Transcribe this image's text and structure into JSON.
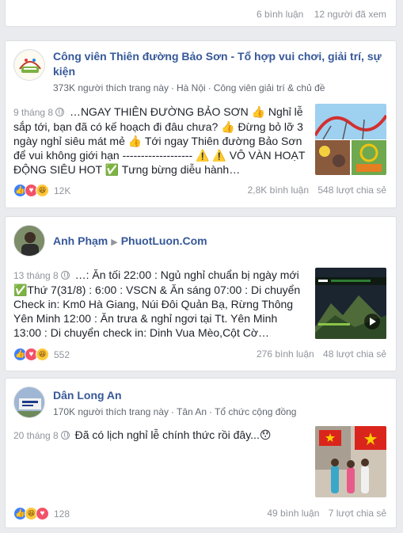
{
  "top_card": {
    "comments": "6 bình luận",
    "views": "12 người đã xem"
  },
  "posts": [
    {
      "name": "Công viên Thiên đường Bảo Sơn - Tổ hợp vui chơi, giải trí, sự kiện",
      "likes": "373K người thích trang này",
      "location": "Hà Nội",
      "category": "Công viên giải trí & chủ đề",
      "date": "9 tháng 8",
      "text": "…NGAY THIÊN ĐƯỜNG BẢO SƠN 👍 Nghỉ lễ sắp tới, bạn đã có kế hoạch đi đâu chưa? 👍 Đừng bỏ lỡ 3 ngày nghỉ siêu mát mẻ 👍 Tới ngay Thiên đường Bảo Sơn để vui không giới hạn ------------------- ⚠️ ⚠️ VÔ VÀN HOẠT ĐỘNG SIÊU HOT ✅ Tưng bừng diễu hành…",
      "reaction_count": "12K",
      "comments": "2,8K bình luận",
      "shares": "548 lượt chia sẻ"
    },
    {
      "name": "Anh Phạm",
      "shared_to": "PhuotLuon.Com",
      "date": "13 tháng 8",
      "text": "…: Ăn tối 22:00 : Ngủ nghỉ chuẩn bị ngày mới ✅Thứ 7(31/8) : 6:00 : VSCN & Ăn sáng 07:00 : Di chuyển Check in: Km0 Hà Giang, Núi Đôi Quản Bạ, Rừng Thông Yên Minh 12:00 : Ăn trưa & nghỉ ngơi tại Tt. Yên Minh 13:00 : Di chuyển check in: Dinh Vua Mèo,Cột Cờ…",
      "reaction_count": "552",
      "comments": "276 bình luận",
      "shares": "48 lượt chia sẻ"
    },
    {
      "name": "Dân Long An",
      "likes": "170K người thích trang này",
      "location": "Tân An",
      "category": "Tổ chức cộng đồng",
      "date": "20 tháng 8",
      "text": "Đã có lịch nghỉ lễ chính thức rồi đây...😯",
      "reaction_count": "128",
      "comments": "49 bình luận",
      "shares": "7 lượt chia sẻ"
    }
  ],
  "colors": {
    "link": "#365899",
    "bg": "#e9ebee",
    "like": "#4080ff",
    "love": "#f25268",
    "haha": "#fcc83b"
  }
}
